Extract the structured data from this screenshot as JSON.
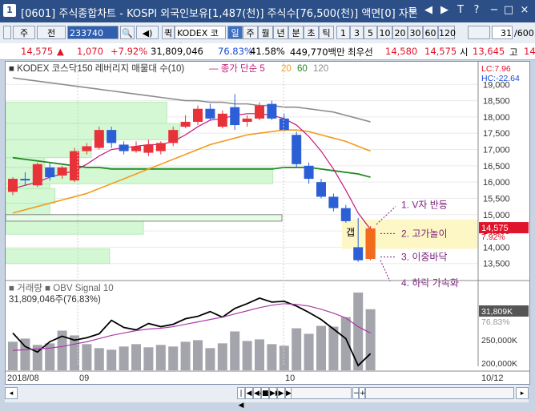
{
  "window": {
    "number": "1",
    "title": "[0601] 주식종합차트 - KOSPI 외국인보유[1,487(천)] 주식수[76,500(천)] 액면[0] 자본",
    "controls": [
      "≡",
      "◀",
      "▶",
      "T",
      "?",
      "−",
      "□",
      "×"
    ]
  },
  "toolbar": {
    "stock_type": "주",
    "search_label": "전",
    "code": "233740",
    "stock_name_prefix": "퀵",
    "stock_name": "KODEX 코스",
    "period_tabs": [
      "일",
      "주",
      "월",
      "년",
      "분",
      "초",
      "틱"
    ],
    "selected_period": "일",
    "intervals": [
      "1",
      "3",
      "5",
      "10",
      "20",
      "30",
      "60",
      "120"
    ],
    "count": "31",
    "count_total": "/600"
  },
  "quote": {
    "price": "14,575",
    "direction": "▲",
    "change": "1,070",
    "change_pct": "+7.92%",
    "volume": "31,809,046",
    "vol_ratio": "76.83%",
    "turnover": "41.58%",
    "amount": "449,770백만",
    "low_label": "최우선",
    "ask": "14,580",
    "bid": "14,575",
    "open_label": "시",
    "open": "13,645",
    "high_label": "고",
    "high": "14"
  },
  "chart_data": [
    {
      "type": "candlestick",
      "title": "KODEX 코스닥150 레버리지 매물대 수(10)",
      "legend": [
        {
          "name": "종가 단순 5",
          "color": "#c2187a"
        },
        {
          "name": "20",
          "color": "#f59a1c"
        },
        {
          "name": "60",
          "color": "#1e8a1e"
        },
        {
          "name": "120",
          "color": "#8c8c8c"
        }
      ],
      "x_labels": [
        "2018/08",
        "09",
        "10",
        "10/12"
      ],
      "ylim": [
        13100,
        19400
      ],
      "y_ticks": [
        13500,
        14000,
        14500,
        15000,
        15500,
        16000,
        16500,
        17000,
        17500,
        18000,
        18500,
        19000
      ],
      "lc_label": "LC:7.96",
      "hc_label": "HC:-22.64",
      "current_price_label": "14,575",
      "current_pct_label": "7.92%",
      "candles": [
        {
          "o": 15700,
          "h": 16150,
          "l": 15600,
          "c": 16100
        },
        {
          "o": 16100,
          "h": 16300,
          "l": 15900,
          "c": 16050
        },
        {
          "o": 15900,
          "h": 16600,
          "l": 15850,
          "c": 16550
        },
        {
          "o": 16450,
          "h": 16600,
          "l": 16050,
          "c": 16150
        },
        {
          "o": 16200,
          "h": 16500,
          "l": 16100,
          "c": 16450
        },
        {
          "o": 16050,
          "h": 17050,
          "l": 16000,
          "c": 16950
        },
        {
          "o": 16950,
          "h": 17200,
          "l": 16850,
          "c": 17100
        },
        {
          "o": 17050,
          "h": 17700,
          "l": 17000,
          "c": 17600
        },
        {
          "o": 17600,
          "h": 17700,
          "l": 17050,
          "c": 17200
        },
        {
          "o": 17150,
          "h": 17250,
          "l": 16850,
          "c": 16950
        },
        {
          "o": 16950,
          "h": 17250,
          "l": 16900,
          "c": 17100
        },
        {
          "o": 16900,
          "h": 17300,
          "l": 16800,
          "c": 17150
        },
        {
          "o": 16950,
          "h": 17250,
          "l": 16850,
          "c": 17200
        },
        {
          "o": 17200,
          "h": 17700,
          "l": 17100,
          "c": 17600
        },
        {
          "o": 17700,
          "h": 18050,
          "l": 17650,
          "c": 17850
        },
        {
          "o": 17850,
          "h": 18350,
          "l": 17750,
          "c": 18250
        },
        {
          "o": 18250,
          "h": 18400,
          "l": 17900,
          "c": 17950
        },
        {
          "o": 17700,
          "h": 18200,
          "l": 17650,
          "c": 18100
        },
        {
          "o": 18300,
          "h": 18700,
          "l": 17600,
          "c": 17750
        },
        {
          "o": 17850,
          "h": 18050,
          "l": 17700,
          "c": 17950
        },
        {
          "o": 17950,
          "h": 18450,
          "l": 17900,
          "c": 18350
        },
        {
          "o": 18400,
          "h": 18500,
          "l": 17900,
          "c": 17950
        },
        {
          "o": 17950,
          "h": 18100,
          "l": 17550,
          "c": 17600
        },
        {
          "o": 17450,
          "h": 17550,
          "l": 16450,
          "c": 16550
        },
        {
          "o": 16500,
          "h": 16600,
          "l": 15950,
          "c": 16100
        },
        {
          "o": 16000,
          "h": 16100,
          "l": 15500,
          "c": 15550
        },
        {
          "o": 15550,
          "h": 15650,
          "l": 15100,
          "c": 15200
        },
        {
          "o": 15200,
          "h": 15300,
          "l": 14750,
          "c": 14800
        },
        {
          "o": 14000,
          "h": 14900,
          "l": 13550,
          "c": 13600
        },
        {
          "o": 13645,
          "h": 14650,
          "l": 13600,
          "c": 14575
        }
      ],
      "ma5": [
        15800,
        15900,
        16000,
        16150,
        16250,
        16350,
        16550,
        16800,
        17000,
        17050,
        17100,
        17150,
        17150,
        17250,
        17450,
        17700,
        17900,
        17950,
        18050,
        18100,
        18100,
        18050,
        17950,
        17750,
        17400,
        16950,
        16400,
        15750,
        15050,
        14550
      ],
      "ma20": [
        15050,
        15150,
        15250,
        15350,
        15450,
        15550,
        15650,
        15800,
        15950,
        16100,
        16250,
        16400,
        16550,
        16700,
        16850,
        17000,
        17150,
        17250,
        17350,
        17450,
        17500,
        17550,
        17600,
        17600,
        17550,
        17450,
        17350,
        17250,
        17100,
        16950
      ],
      "ma60": [
        16750,
        16700,
        16650,
        16600,
        16550,
        16500,
        16450,
        16450,
        16400,
        16400,
        16400,
        16400,
        16400,
        16400,
        16400,
        16400,
        16400,
        16400,
        16400,
        16400,
        16400,
        16400,
        16450,
        16450,
        16450,
        16400,
        16350,
        16300,
        16250,
        16150
      ],
      "ma120": [
        19200,
        19150,
        19100,
        19050,
        19000,
        18950,
        18900,
        18850,
        18800,
        18750,
        18700,
        18650,
        18600,
        18550,
        18500,
        18500,
        18450,
        18450,
        18400,
        18400,
        18350,
        18350,
        18300,
        18300,
        18250,
        18200,
        18150,
        18050,
        17950,
        17850
      ],
      "volume_profile": [
        {
          "price_lo": 17800,
          "price_hi": 18450,
          "value": 0.62
        },
        {
          "price_lo": 17300,
          "price_hi": 17800,
          "value": 0.67
        },
        {
          "price_lo": 16750,
          "price_hi": 17300,
          "value": 0.33
        },
        {
          "price_lo": 16350,
          "price_hi": 16750,
          "value": 0.15
        },
        {
          "price_lo": 15800,
          "price_hi": 16350,
          "value": 0.17
        },
        {
          "price_lo": 15350,
          "price_hi": 15800,
          "value": 0.19
        },
        {
          "price_lo": 14950,
          "price_hi": 15350,
          "value": 0.17
        },
        {
          "price_lo": 14400,
          "price_hi": 14850,
          "value": 0.53
        },
        {
          "price_lo": 13950,
          "price_hi": 14400,
          "value": 0.0
        },
        {
          "price_lo": 13500,
          "price_hi": 13950,
          "value": 0.4
        }
      ],
      "highlight_zones": [
        {
          "label": "",
          "price_lo": 15950,
          "price_hi": 16450,
          "value": 0.87
        }
      ],
      "annotations": {
        "gap_label": "갭",
        "notes": [
          "1. V자 반등",
          "2. 고가놀이",
          "3. 이중바닥",
          "4. 하락 가속화"
        ]
      }
    },
    {
      "type": "bar+line",
      "title": "거래량",
      "series_names": [
        "OBV",
        "Signal 10"
      ],
      "volume_label": "31,809,046주(76.83%)",
      "right_labels": [
        "31,809K",
        "76.83%",
        "250,000K",
        "200,000K"
      ],
      "volume": [
        0.36,
        0.4,
        0.32,
        0.34,
        0.5,
        0.44,
        0.33,
        0.28,
        0.26,
        0.3,
        0.33,
        0.29,
        0.32,
        0.3,
        0.36,
        0.38,
        0.28,
        0.34,
        0.49,
        0.37,
        0.39,
        0.33,
        0.31,
        0.53,
        0.46,
        0.56,
        0.55,
        0.67,
        0.98,
        0.77
      ],
      "obv": [
        0.47,
        0.3,
        0.23,
        0.36,
        0.43,
        0.38,
        0.41,
        0.46,
        0.63,
        0.54,
        0.51,
        0.59,
        0.55,
        0.58,
        0.65,
        0.68,
        0.74,
        0.67,
        0.78,
        0.84,
        0.91,
        0.86,
        0.87,
        0.81,
        0.73,
        0.64,
        0.52,
        0.4,
        0.06,
        0.21
      ],
      "signal": [
        0.25,
        0.26,
        0.27,
        0.28,
        0.3,
        0.33,
        0.36,
        0.4,
        0.44,
        0.47,
        0.5,
        0.52,
        0.53,
        0.55,
        0.58,
        0.61,
        0.64,
        0.67,
        0.71,
        0.75,
        0.79,
        0.82,
        0.84,
        0.83,
        0.81,
        0.77,
        0.72,
        0.66,
        0.55,
        0.47
      ]
    }
  ],
  "bottombar": {
    "buttons": [
      "|◀",
      "◀",
      "◀◀",
      "■",
      "▶▶",
      "▶",
      "▶|"
    ],
    "zoom_buttons": [
      "−",
      "+"
    ]
  }
}
